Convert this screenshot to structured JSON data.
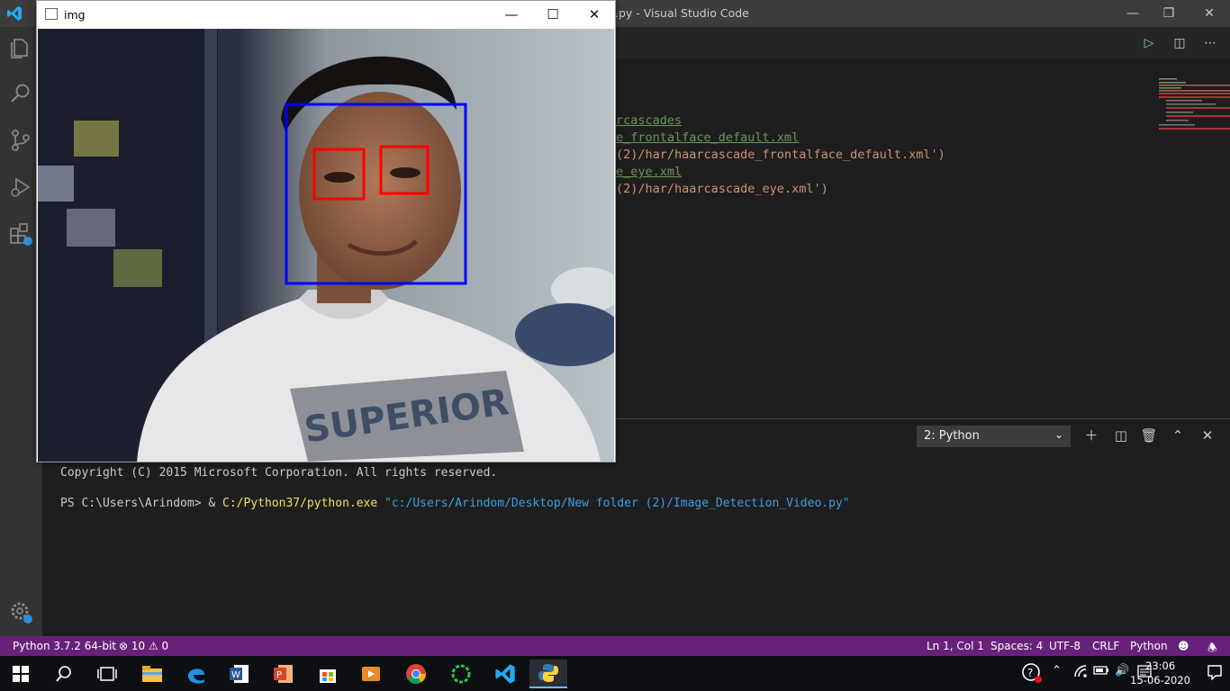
{
  "vscode": {
    "window_title": ".py - Visual Studio Code",
    "code_lines": [
      {
        "text": "rcascades",
        "cls": "c-green"
      },
      {
        "text": "e_frontalface_default.xml",
        "cls": "c-green"
      },
      {
        "text": "(2)/har/haarcascade_frontalface_default.xml')",
        "cls": "c-str"
      },
      {
        "text": "e_eye.xml",
        "cls": "c-green"
      },
      {
        "text": "(2)/har/haarcascade_eye.xml')",
        "cls": "c-str"
      }
    ],
    "terminal_selected": "2: Python",
    "terminal_line1": "Copyright (C) 2015 Microsoft Corporation. All rights reserved.",
    "terminal_prompt": "PS C:\\Users\\Arindom> & ",
    "terminal_exe": "C:/Python37/python.exe",
    "terminal_arg": " \"c:/Users/Arindom/Desktop/New folder (2)/Image_Detection_Video.py\""
  },
  "statusbar": {
    "interpreter": "Python 3.7.2 64-bit",
    "problems": "⊗ 10 ⚠ 0",
    "position": "Ln 1, Col 1",
    "spaces": "Spaces: 4",
    "encoding": "UTF-8",
    "eol": "CRLF",
    "language": "Python"
  },
  "cv_window": {
    "title": "img",
    "face_box_color": "#0000ff",
    "eye_box_color": "#ff0000",
    "shirt_text": "SUPERIOR"
  },
  "taskbar": {
    "time": "23:06",
    "date": "15-06-2020"
  },
  "colors": {
    "statusbar": "#68217a",
    "accent": "#007acc"
  }
}
